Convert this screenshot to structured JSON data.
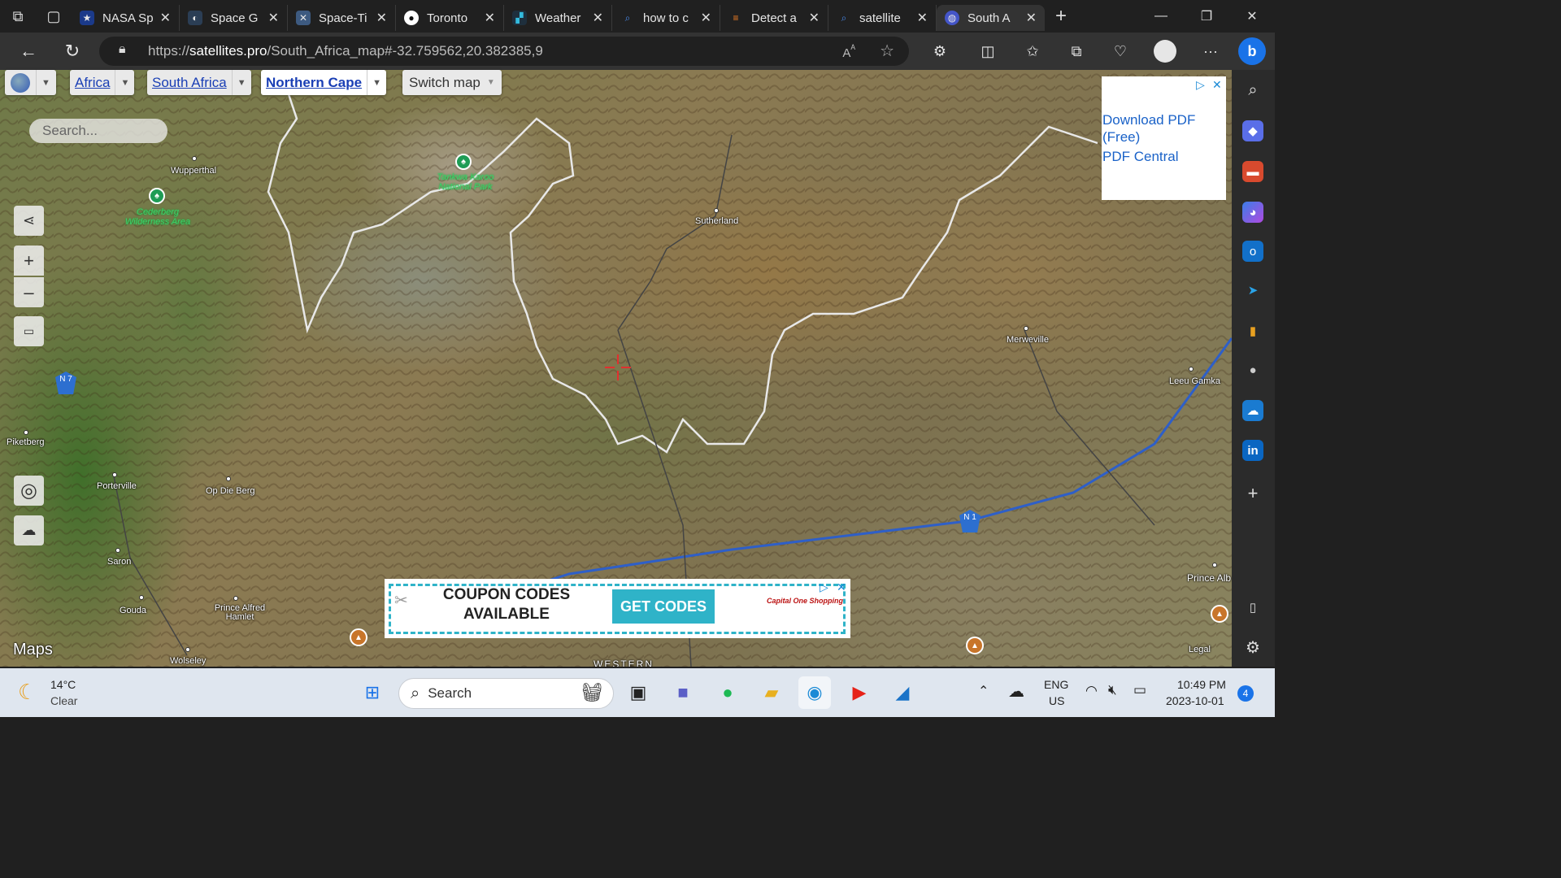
{
  "browser": {
    "tabs": [
      {
        "label": "NASA Sp",
        "favicon": "nasa-icon"
      },
      {
        "label": "Space G",
        "favicon": "globe-icon"
      },
      {
        "label": "Space-Ti",
        "favicon": "satellite-icon"
      },
      {
        "label": "Toronto",
        "favicon": "github-icon"
      },
      {
        "label": "Weather",
        "favicon": "weather-icon"
      },
      {
        "label": "how to c",
        "favicon": "search-icon"
      },
      {
        "label": "Detect a",
        "favicon": "stackoverflow-icon"
      },
      {
        "label": "satellite",
        "favicon": "search-icon"
      },
      {
        "label": "South A",
        "favicon": "globe-icon",
        "active": true
      }
    ],
    "url_prefix": "https://",
    "url_host": "satellites.pro",
    "url_path": "/South_Africa_map#-32.759562,20.382385,9"
  },
  "map": {
    "breadcrumbs": [
      "Africa",
      "South Africa",
      "Northern Cape"
    ],
    "switch_label": "Switch map",
    "search_placeholder": "Search...",
    "attribution": "Maps",
    "legal": "Legal",
    "bottom_label": "WESTERN",
    "places": [
      {
        "name": "Wupperthal"
      },
      {
        "name": "Sutherland"
      },
      {
        "name": "Merweville"
      },
      {
        "name": "Leeu Gamka"
      },
      {
        "name": "Piketberg"
      },
      {
        "name": "Porterville"
      },
      {
        "name": "Op Die Berg"
      },
      {
        "name": "Saron"
      },
      {
        "name": "Gouda"
      },
      {
        "name": "Prince Alfred Hamlet"
      },
      {
        "name": "Wolseley"
      },
      {
        "name": "Prince Alb"
      }
    ],
    "parks": [
      {
        "name": "Tankwa Karoo National Park"
      },
      {
        "name": "Cederberg Wilderness Area"
      }
    ],
    "routes": [
      {
        "label": "N 7"
      },
      {
        "label": "N 1"
      }
    ]
  },
  "ads": {
    "side_line1": "Download PDF (Free)",
    "side_line2": "PDF Central",
    "coupon_text": "COUPON CODES AVAILABLE",
    "coupon_button": "GET CODES",
    "coupon_brand": "Capital One Shopping"
  },
  "taskbar": {
    "weather_temp": "14°C",
    "weather_desc": "Clear",
    "search_label": "Search",
    "lang": "ENG",
    "region": "US",
    "time": "10:49 PM",
    "date": "2023-10-01",
    "notif_count": "4"
  }
}
